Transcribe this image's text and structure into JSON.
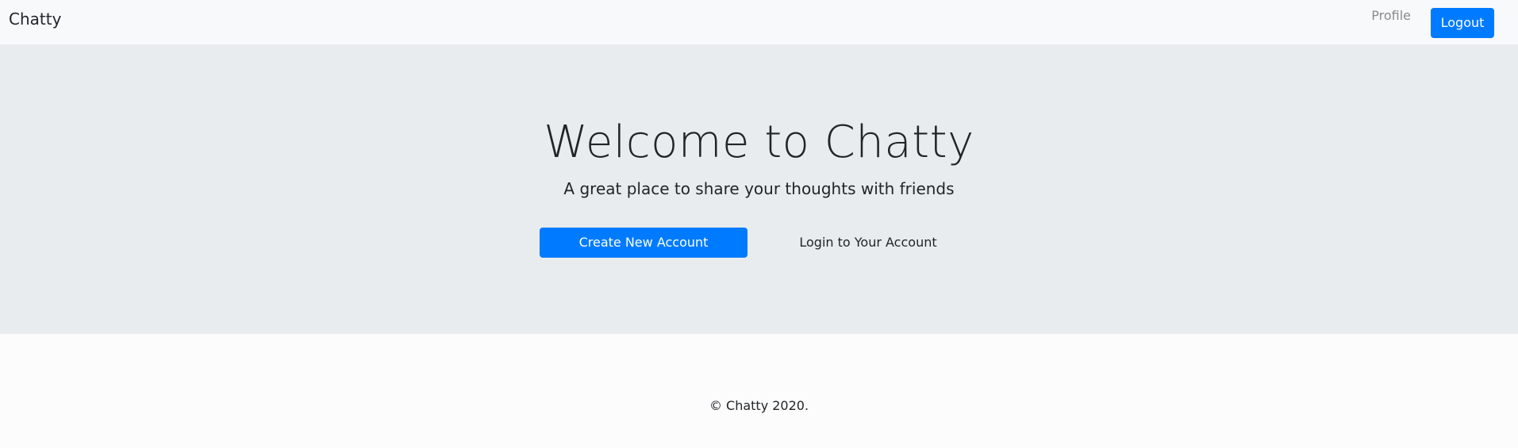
{
  "navbar": {
    "brand": "Chatty",
    "profile_label": "Profile",
    "logout_label": "Logout"
  },
  "hero": {
    "title": "Welcome to Chatty",
    "subtitle": "A great place to share your thoughts with friends",
    "create_account_label": "Create New Account",
    "login_label": "Login to Your Account"
  },
  "footer": {
    "copyright": "© Chatty 2020."
  },
  "colors": {
    "primary": "#007bff",
    "navbar_bg": "#f8f9fa",
    "hero_bg": "#e9ecef",
    "text": "#212529",
    "muted": "#8a8a8a"
  }
}
